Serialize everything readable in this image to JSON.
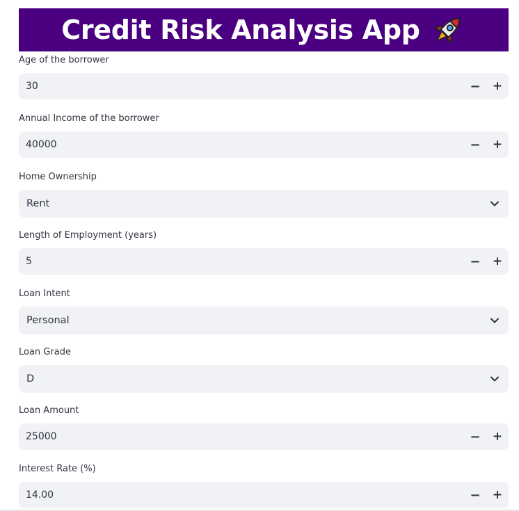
{
  "app": {
    "title": "Credit Risk Analysis App",
    "title_icon": "rocket-icon"
  },
  "fields": {
    "age": {
      "label": "Age of the borrower",
      "value": "30",
      "minus": "−",
      "plus": "+"
    },
    "income": {
      "label": "Annual Income of the borrower",
      "value": "40000",
      "minus": "−",
      "plus": "+"
    },
    "home": {
      "label": "Home Ownership",
      "value": "Rent"
    },
    "emp": {
      "label": "Length of Employment (years)",
      "value": "5",
      "minus": "−",
      "plus": "+"
    },
    "intent": {
      "label": "Loan Intent",
      "value": "Personal"
    },
    "grade": {
      "label": "Loan Grade",
      "value": "D"
    },
    "amount": {
      "label": "Loan Amount",
      "value": "25000",
      "minus": "−",
      "plus": "+"
    },
    "rate": {
      "label": "Interest Rate (%)",
      "value": "14.00",
      "minus": "−",
      "plus": "+"
    }
  },
  "colors": {
    "banner": "#4b0082",
    "input_bg": "#f0f2f6",
    "text": "#31333f"
  }
}
